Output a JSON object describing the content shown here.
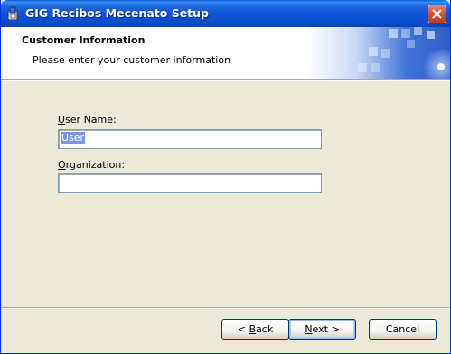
{
  "window": {
    "title": "GIG Recibos Mecenato Setup",
    "icon": "setup-installer-icon",
    "close_icon": "close-x-icon"
  },
  "banner": {
    "title": "Customer Information",
    "subtitle": "Please enter your customer information"
  },
  "form": {
    "user_name": {
      "label_mnemonic": "U",
      "label_rest": "ser Name:",
      "value": "User"
    },
    "organization": {
      "label_mnemonic": "O",
      "label_rest": "rganization:",
      "value": ""
    }
  },
  "buttons": {
    "back": {
      "prefix": "< ",
      "mnemonic": "B",
      "rest": "ack"
    },
    "next": {
      "mnemonic": "N",
      "rest": "ext >"
    },
    "cancel": {
      "label": "Cancel"
    }
  },
  "colors": {
    "titlebar": "#0a55d6",
    "window_bg": "#ece9d8",
    "selection": "#7a96df",
    "close_button": "#d6532d"
  }
}
